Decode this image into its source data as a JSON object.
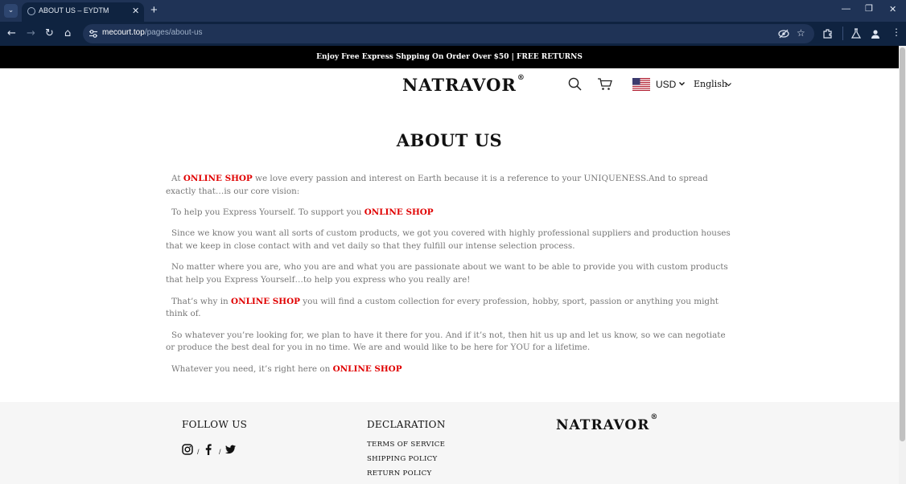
{
  "browser": {
    "tab_title": "ABOUT US – EYDTM",
    "url_host": "mecourt.top",
    "url_path": "/pages/about-us"
  },
  "announcement": "Enjoy Free Express Shpping On Order Over $50 | FREE RETURNS",
  "header": {
    "logo": "NATRAVOR",
    "logo_mark": "®",
    "currency": "USD",
    "language": "English"
  },
  "page_title": "ABOUT US",
  "paragraphs": [
    [
      "At ",
      "ONLINE SHOP",
      " we love every passion and interest on Earth because it is a reference to your UNIQUENESS.And to spread exactly that…is our core vision:"
    ],
    [
      "To help you Express Yourself. To support you ",
      "ONLINE SHOP",
      ""
    ],
    [
      "Since we know you want all sorts of custom products, we got you covered with highly professional suppliers and production houses that we keep in close contact with and vet daily so that they fulfill our intense selection process.",
      "",
      ""
    ],
    [
      "No matter where you are, who you are and what you are passionate about we want to be able to provide you with custom products that help you Express Yourself…to help you express who you really are!",
      "",
      ""
    ],
    [
      "That’s why in ",
      "ONLINE SHOP",
      " you will find a custom collection for every profession, hobby, sport, passion or anything you might think of."
    ],
    [
      "So whatever you’re looking for, we plan to have it there for you. And if it’s not, then hit us up and let us know, so we can negotiate or produce the best deal for you in no time. We are and would like to be here for YOU for a lifetime.",
      "",
      ""
    ],
    [
      "Whatever you need, it’s right here on ",
      "ONLINE SHOP",
      ""
    ]
  ],
  "footer": {
    "follow_heading": "FOLLOW US",
    "social_separator": "/",
    "declaration_heading": "DECLARATION",
    "links": [
      "TERMS OF SERVICE",
      "SHIPPING POLICY",
      "RETURN POLICY"
    ],
    "logo": "NATRAVOR",
    "logo_mark": "®"
  },
  "icons": {
    "tab_list": "chevron-down-icon",
    "favicon": "globe-icon",
    "back": "arrow-left-icon",
    "forward": "arrow-right-icon",
    "reload": "reload-icon",
    "home": "home-icon",
    "site_info": "tune-icon",
    "eye_off": "eye-off-icon",
    "bookmark": "star-icon",
    "extensions": "puzzle-icon",
    "labs": "flask-icon",
    "profile": "person-icon",
    "menu": "kebab-menu-icon",
    "search": "search-icon",
    "cart": "cart-icon",
    "flag": "us-flag-icon",
    "instagram": "instagram-icon",
    "facebook": "facebook-icon",
    "twitter": "twitter-icon"
  },
  "colors": {
    "highlight": "#e00000",
    "body_text": "#777777",
    "chrome_bg": "#0f2340"
  }
}
